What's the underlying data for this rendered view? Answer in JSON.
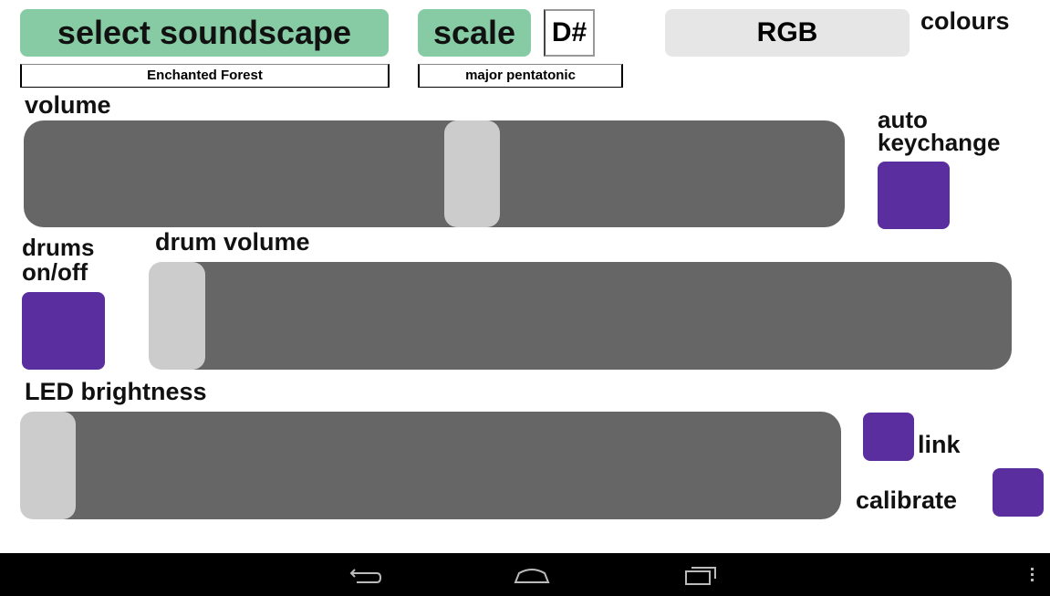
{
  "header": {
    "soundscape_button": "select soundscape",
    "soundscape_value": "Enchanted Forest",
    "scale_button": "scale",
    "key_value": "D#",
    "scale_value": "major pentatonic",
    "rgb_button": "RGB",
    "colours_label": "colours"
  },
  "volume": {
    "label": "volume",
    "level": 0.55
  },
  "auto_keychange": {
    "label_line1": "auto",
    "label_line2": "keychange"
  },
  "drums": {
    "label_line1": "drums",
    "label_line2": "on/off"
  },
  "drum_volume": {
    "label": "drum volume",
    "level": 0.0
  },
  "led_brightness": {
    "label": "LED brightness",
    "level": 0.0
  },
  "link": {
    "label": "link"
  },
  "calibrate": {
    "label": "calibrate"
  },
  "colors": {
    "accent_green": "#86cba4",
    "toggle_purple": "#5b2ea0",
    "slider_track": "#666666",
    "slider_thumb": "#cccccc"
  },
  "navbar": {
    "icons": [
      "back-icon",
      "home-icon",
      "recent-apps-icon",
      "menu-icon"
    ]
  }
}
